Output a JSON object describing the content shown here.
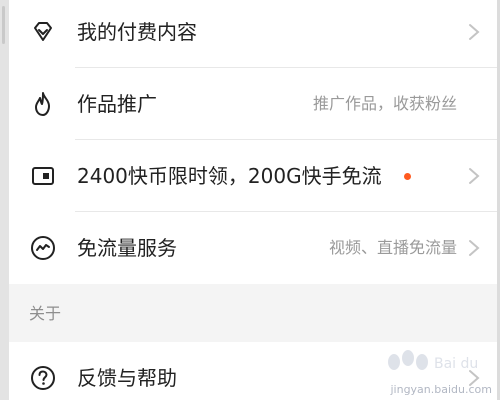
{
  "menu": {
    "paid_content": {
      "label": "我的付费内容",
      "icon": "diamond-icon"
    },
    "promote": {
      "label": "作品推广",
      "hint": "推广作品，收获粉丝",
      "icon": "flame-icon"
    },
    "coin_offer": {
      "label": "2400快币限时领，200G快手免流",
      "icon": "sim-card-icon",
      "badge_color": "#ff5a1f"
    },
    "free_data": {
      "label": "免流量服务",
      "hint": "视频、直播免流量",
      "icon": "wave-circle-icon"
    },
    "feedback": {
      "label": "反馈与帮助",
      "icon": "question-circle-icon"
    }
  },
  "sections": {
    "about": "关于"
  },
  "watermark": {
    "domain": "jingyan.baidu.com"
  },
  "colors": {
    "accent_dot": "#ff5a1f",
    "text_primary": "#222222",
    "text_secondary": "#9a9a9a"
  }
}
